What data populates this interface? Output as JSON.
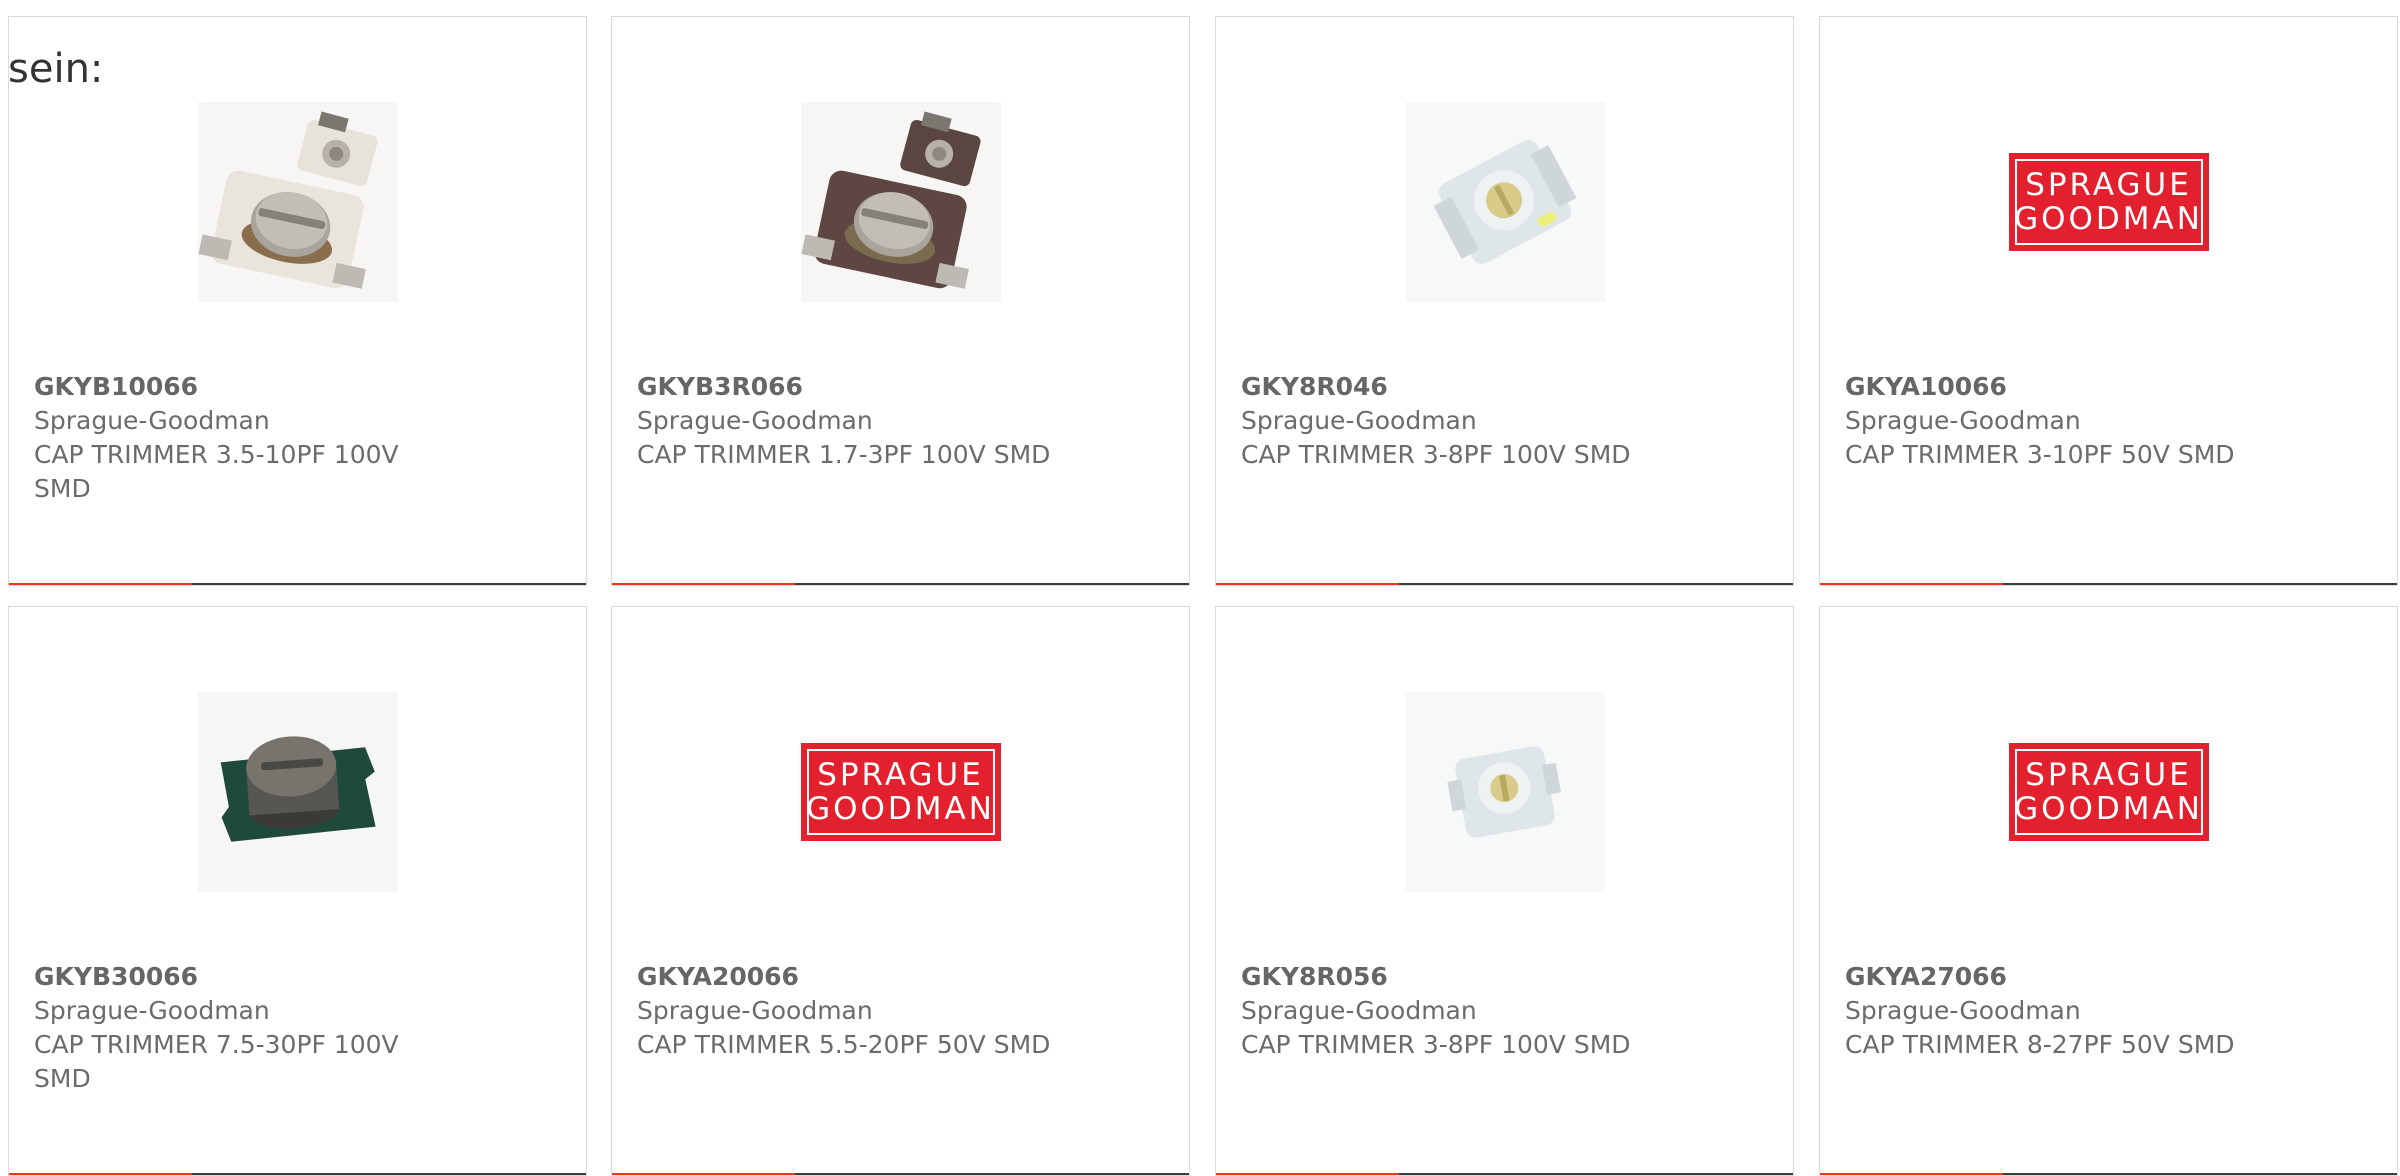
{
  "intro_text": "sein:",
  "logo": {
    "line1": "SPRAGUE",
    "line2": "GOODMAN",
    "color": "#e3202e"
  },
  "accent_color": "#e63b12",
  "products": [
    {
      "part_number": "GKYB10066",
      "manufacturer": "Sprague-Goodman",
      "description": "CAP TRIMMER 3.5-10PF 100V SMD",
      "image": "trimmer-white-pair-icon"
    },
    {
      "part_number": "GKYB3R066",
      "manufacturer": "Sprague-Goodman",
      "description": "CAP TRIMMER 1.7-3PF 100V SMD",
      "image": "trimmer-brown-pair-icon"
    },
    {
      "part_number": "GKY8R046",
      "manufacturer": "Sprague-Goodman",
      "description": "CAP TRIMMER 3-8PF 100V SMD",
      "image": "trimmer-white-tilted-icon"
    },
    {
      "part_number": "GKYA10066",
      "manufacturer": "Sprague-Goodman",
      "description": "CAP TRIMMER 3-10PF 50V SMD",
      "image": "sprague-goodman-logo"
    },
    {
      "part_number": "GKYB30066",
      "manufacturer": "Sprague-Goodman",
      "description": "CAP TRIMMER 7.5-30PF 100V SMD",
      "image": "trimmer-green-icon"
    },
    {
      "part_number": "GKYA20066",
      "manufacturer": "Sprague-Goodman",
      "description": "CAP TRIMMER 5.5-20PF 50V SMD",
      "image": "sprague-goodman-logo"
    },
    {
      "part_number": "GKY8R056",
      "manufacturer": "Sprague-Goodman",
      "description": "CAP TRIMMER 3-8PF 100V SMD",
      "image": "trimmer-white-small-icon"
    },
    {
      "part_number": "GKYA27066",
      "manufacturer": "Sprague-Goodman",
      "description": "CAP TRIMMER 8-27PF 50V SMD",
      "image": "sprague-goodman-logo"
    }
  ]
}
